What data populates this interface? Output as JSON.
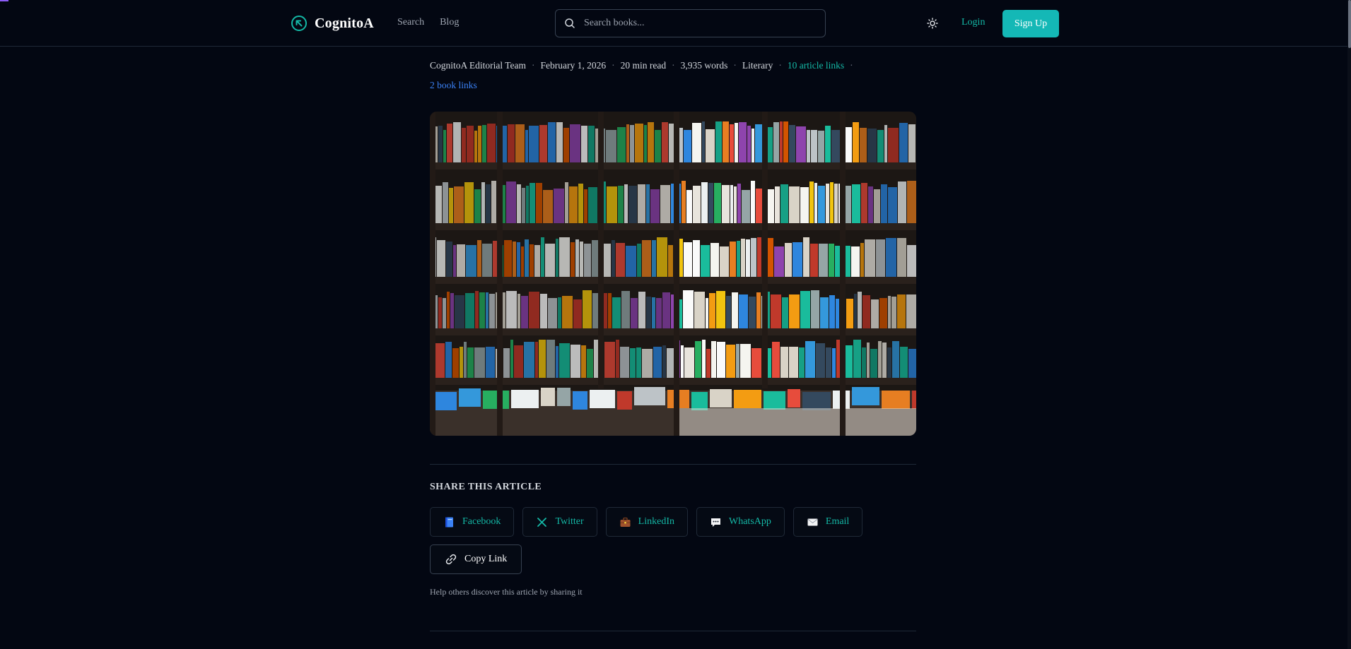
{
  "header": {
    "logo_text": "CognitoA",
    "nav": [
      "Search",
      "Blog"
    ],
    "search_placeholder": "Search books...",
    "login_label": "Login",
    "signup_label": "Sign Up"
  },
  "meta": {
    "author": "CognitoA Editorial Team",
    "date": "February 1, 2026",
    "read_time": "20 min read",
    "words": "3,935 words",
    "category": "Literary",
    "article_links": "10 article links",
    "book_links": "2 book links"
  },
  "share": {
    "title": "SHARE THIS ARTICLE",
    "buttons": [
      {
        "label": "Facebook",
        "icon": "book-icon"
      },
      {
        "label": "Twitter",
        "icon": "x-icon"
      },
      {
        "label": "LinkedIn",
        "icon": "briefcase-icon"
      },
      {
        "label": "WhatsApp",
        "icon": "speech-bubble-icon"
      },
      {
        "label": "Email",
        "icon": "envelope-icon"
      }
    ],
    "copy_label": "Copy Link",
    "help_text": "Help others discover this article by sharing it"
  },
  "colors": {
    "accent": "#14b8a6",
    "link_blue": "#3b82f6",
    "background": "#030712"
  }
}
